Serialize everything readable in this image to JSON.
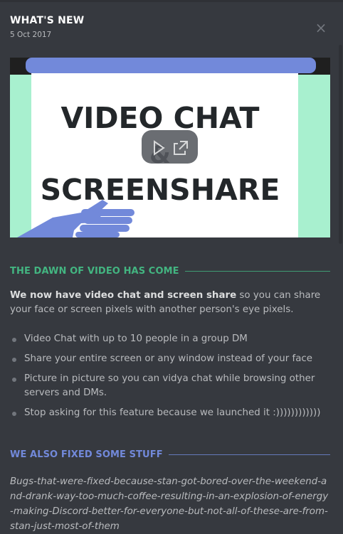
{
  "modal": {
    "title": "WHAT'S NEW",
    "date": "5 Oct 2017",
    "close_icon": "×"
  },
  "media": {
    "headline_top": "VIDEO CHAT",
    "ampersand": "&",
    "headline_bottom": "SCREENSHARE",
    "play_icon": "play-icon",
    "popout_icon": "popout-icon"
  },
  "sections": [
    {
      "heading": "THE DAWN OF VIDEO HAS COME",
      "color": "#43b581",
      "intro_bold": "We now have video chat and screen share",
      "intro_rest": " so you can share your face or screen pixels with another person's eye pixels.",
      "bullets": [
        "Video Chat with up to 10 people in a group DM",
        "Share your entire screen or any window instead of your face",
        "Picture in picture so you can vidya chat while browsing other servers and DMs.",
        "Stop asking for this feature because we launched it :))))))))))))"
      ]
    },
    {
      "heading": "WE ALSO FIXED SOME STUFF",
      "color": "#7289da",
      "text": "Bugs-that-were-fixed-because-stan-got-bored-over-the-weekend-and-drank-way-too-much-coffee-resulting-in-an-explosion-of-energy-making-Discord-better-for-everyone-but-not-all-of-these-are-from-stan-just-most-of-them"
    }
  ]
}
